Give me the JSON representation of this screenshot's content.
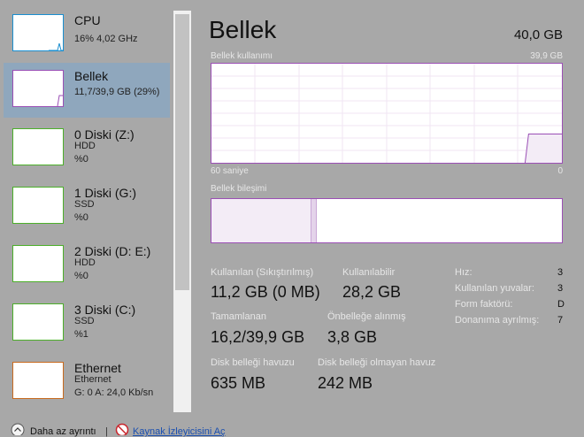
{
  "sidebar": {
    "items": [
      {
        "title": "CPU",
        "line1": "16% 4,02 GHz",
        "line2": "",
        "line3": "",
        "icon": "cpu-graph-icon",
        "color": "#1a8fd0"
      },
      {
        "title": "Bellek",
        "line1": "11,7/39,9 GB (29%)",
        "line2": "",
        "line3": "",
        "icon": "memory-graph-icon",
        "color": "#9b4fb5"
      },
      {
        "title": "0 Diski (Z:)",
        "line1": "HDD",
        "line2": "%0",
        "line3": "",
        "icon": "disk-graph-icon",
        "color": "#4caf2a"
      },
      {
        "title": "1 Diski (G:)",
        "line1": "SSD",
        "line2": "%0",
        "line3": "",
        "icon": "disk-graph-icon",
        "color": "#4caf2a"
      },
      {
        "title": "2 Diski (D: E:)",
        "line1": "HDD",
        "line2": "%0",
        "line3": "",
        "icon": "disk-graph-icon",
        "color": "#4caf2a"
      },
      {
        "title": "3 Diski (C:)",
        "line1": "SSD",
        "line2": "%1",
        "line3": "",
        "icon": "disk-graph-icon",
        "color": "#4caf2a"
      },
      {
        "title": "Ethernet",
        "line1": "Ethernet",
        "line2": "G: 0 A: 24,0 Kb/sn",
        "line3": "",
        "icon": "network-graph-icon",
        "color": "#c86a1e"
      }
    ]
  },
  "main": {
    "title": "Bellek",
    "total": "40,0 GB",
    "usage_label": "Bellek kullanımı",
    "usage_max": "39,9 GB",
    "time_label": "60 saniye",
    "time_min": "0",
    "composition_label": "Bellek bileşimi",
    "stats": {
      "in_use_label": "Kullanılan (Sıkıştırılmış)",
      "in_use_value": "11,2 GB (0 MB)",
      "available_label": "Kullanılabilir",
      "available_value": "28,2 GB",
      "committed_label": "Tamamlanan",
      "committed_value": "16,2/39,9 GB",
      "cached_label": "Önbelleğe alınmış",
      "cached_value": "3,8 GB",
      "paged_label": "Disk belleği havuzu",
      "paged_value": "635 MB",
      "nonpaged_label": "Disk belleği olmayan havuz",
      "nonpaged_value": "242 MB"
    },
    "specs": {
      "speed_label": "Hız:",
      "speed_value": "3",
      "slots_label": "Kullanılan yuvalar:",
      "slots_value": "3",
      "form_label": "Form faktörü:",
      "form_value": "D",
      "reserved_label": "Donanıma ayrılmış:",
      "reserved_value": "7"
    },
    "usage_fraction": 0.29
  },
  "footer": {
    "fewer_details": "Daha az ayrıntı",
    "separator": "|",
    "resource_monitor": "Kaynak İzleyicisini Aç"
  },
  "colors": {
    "accent_memory": "#9b4fb5",
    "selected_bg": "#8fa7bd",
    "link": "#1a4fb0"
  }
}
